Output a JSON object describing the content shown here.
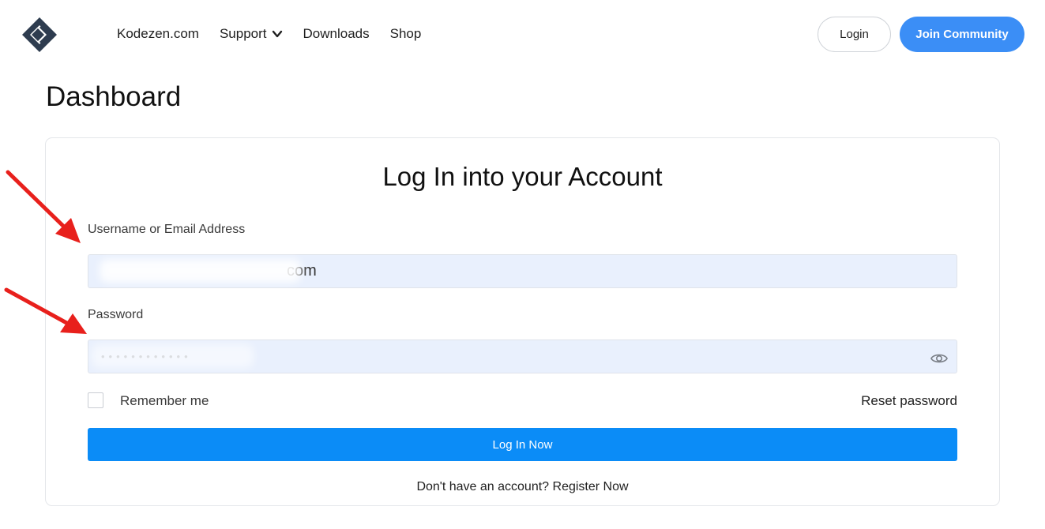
{
  "header": {
    "nav": [
      {
        "label": "Kodezen.com"
      },
      {
        "label": "Support"
      },
      {
        "label": "Downloads"
      },
      {
        "label": "Shop"
      }
    ],
    "login_label": "Login",
    "join_label": "Join Community"
  },
  "page": {
    "title": "Dashboard"
  },
  "form": {
    "title": "Log In into your Account",
    "username_label": "Username or Email Address",
    "username_value": "com",
    "password_label": "Password",
    "password_value": "••••••••••••",
    "remember_label": "Remember me",
    "reset_label": "Reset password",
    "submit_label": "Log In Now",
    "register_prompt": "Don't have an account?",
    "register_link": "Register Now"
  },
  "colors": {
    "accent": "#0b8cf7",
    "join_button": "#3b8ef6",
    "field_bg": "#e9f0fd",
    "annotation_arrow": "#e8201c"
  }
}
